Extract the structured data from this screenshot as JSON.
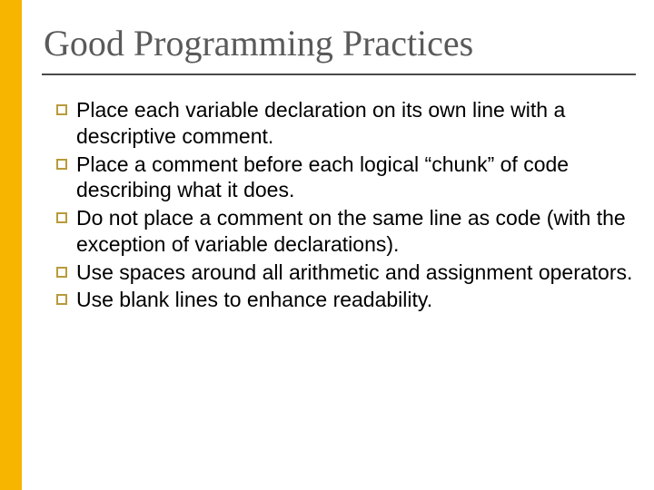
{
  "slide": {
    "title": "Good Programming Practices",
    "bullets": [
      "Place each variable declaration on its own line with a descriptive comment.",
      "Place a comment before each logical “chunk” of code describing what it does.",
      "Do not place a comment on the same line as code (with the exception of variable declarations).",
      "Use spaces around all arithmetic and assignment operators.",
      "Use blank lines to enhance readability."
    ]
  }
}
